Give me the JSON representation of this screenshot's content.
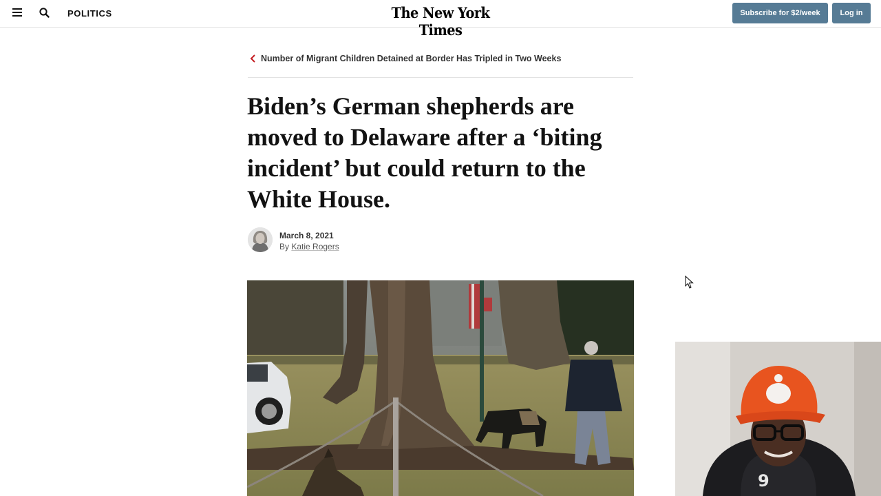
{
  "header": {
    "menu_icon": "hamburger-menu-icon",
    "search_icon": "search-icon",
    "section": "POLITICS",
    "masthead": "The New York Times",
    "subscribe_label": "Subscribe for $2/week",
    "login_label": "Log in",
    "button_color": "#567b95"
  },
  "related": {
    "icon": "chevron-left-icon",
    "icon_color": "#c41d22",
    "text": "Number of Migrant Children Detained at Border Has Tripled in Two Weeks"
  },
  "article": {
    "headline": "Biden’s German shepherds are moved to Delaware after a ‘biting incident’ but could return to the White House.",
    "date": "March 8, 2021",
    "by_prefix": "By ",
    "author": "Katie Rogers"
  },
  "photo": {
    "alt": "Photo of the White House lawn with a man walking a German shepherd near large trees"
  },
  "overlay": {
    "webcam": "streamer-webcam-feed"
  }
}
